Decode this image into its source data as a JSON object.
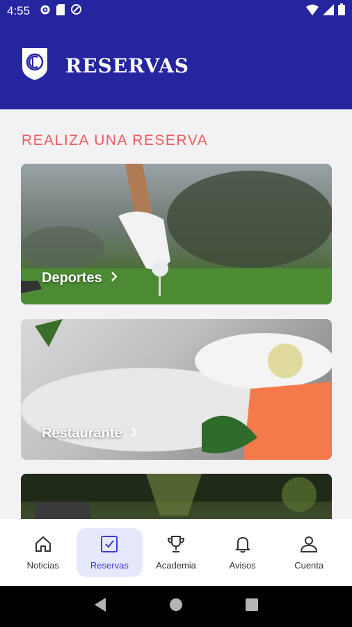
{
  "status": {
    "time": "4:55"
  },
  "header": {
    "title": "RESERVAS"
  },
  "main": {
    "section_title": "REALIZA UNA RESERVA",
    "cards": [
      {
        "label": "Deportes"
      },
      {
        "label": "Restaurante"
      },
      {
        "label": ""
      }
    ]
  },
  "nav": {
    "items": [
      {
        "label": "Noticias",
        "icon": "home-icon"
      },
      {
        "label": "Reservas",
        "icon": "checkbox-icon"
      },
      {
        "label": "Academia",
        "icon": "trophy-icon"
      },
      {
        "label": "Avisos",
        "icon": "bell-icon"
      },
      {
        "label": "Cuenta",
        "icon": "user-icon"
      }
    ],
    "active_index": 1
  },
  "colors": {
    "brand": "#2525a0",
    "accent": "#f05a5a",
    "active_nav_bg": "#e6e8fb",
    "active_nav_fg": "#3b3bd6"
  }
}
